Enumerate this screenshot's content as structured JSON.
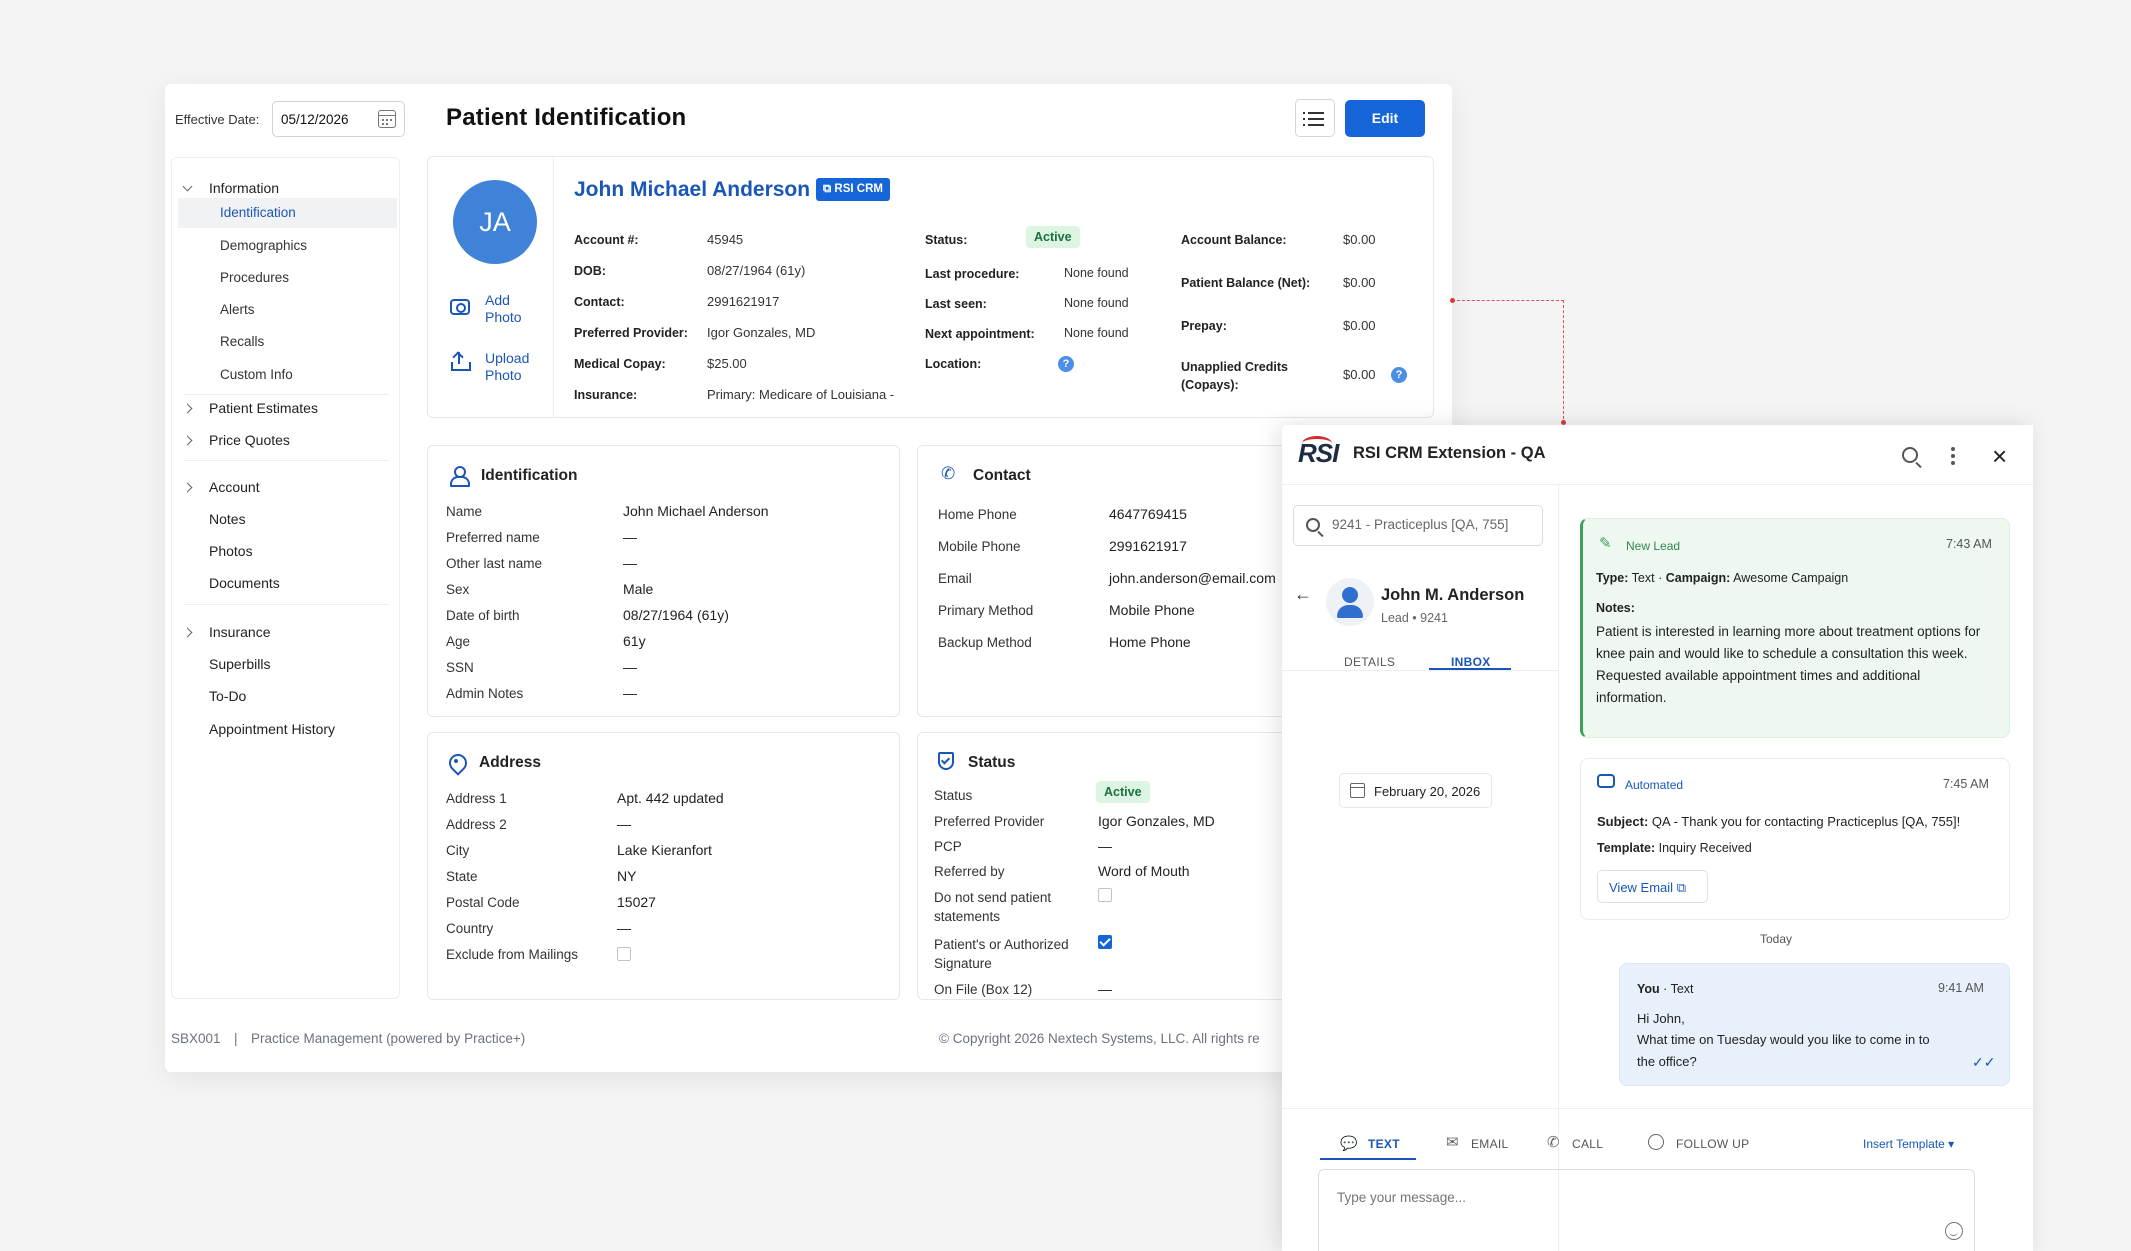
{
  "header": {
    "effective_date_label": "Effective Date:",
    "effective_date_value": "05/12/2026",
    "page_title": "Patient Identification",
    "edit_label": "Edit"
  },
  "nav": {
    "information": "Information",
    "info_items": [
      "Identification",
      "Demographics",
      "Procedures",
      "Alerts",
      "Recalls",
      "Custom Info"
    ],
    "patient_estimates": "Patient Estimates",
    "price_quotes": "Price Quotes",
    "account": "Account",
    "account_items": [
      "Notes",
      "Photos",
      "Documents"
    ],
    "insurance": "Insurance",
    "insurance_items": [
      "Superbills",
      "To-Do",
      "Appointment History"
    ]
  },
  "footer": {
    "code": "SBX001",
    "sep": "|",
    "product": "Practice Management (powered by Practice+)",
    "copyright": "© Copyright 2026 Nextech Systems, LLC. All rights re"
  },
  "summary": {
    "initials": "JA",
    "add_photo": "Add Photo",
    "upload_photo": "Upload Photo",
    "name": "John Michael Anderson",
    "crm_badge": "RSI CRM",
    "col1": [
      [
        "Account #:",
        "45945"
      ],
      [
        "DOB:",
        "08/27/1964 (61y)"
      ],
      [
        "Contact:",
        "2991621917"
      ],
      [
        "Preferred Provider:",
        "Igor Gonzales, MD"
      ],
      [
        "Medical Copay:",
        "$25.00"
      ],
      [
        "Insurance:",
        "Primary: Medicare of Louisiana -"
      ]
    ],
    "status_label": "Status:",
    "status_value": "Active",
    "col2": [
      [
        "Last procedure:",
        "None found"
      ],
      [
        "Last seen:",
        "None found"
      ],
      [
        "Next appointment:",
        "None found"
      ],
      [
        "Location:",
        ""
      ]
    ],
    "col3": [
      [
        "Account Balance:",
        "$0.00"
      ],
      [
        "Patient Balance (Net):",
        "$0.00"
      ],
      [
        "Prepay:",
        "$0.00"
      ],
      [
        "Unapplied Credits (Copays):",
        "$0.00"
      ]
    ]
  },
  "identification": {
    "title": "Identification",
    "rows": [
      [
        "Name",
        "John Michael Anderson"
      ],
      [
        "Preferred name",
        "—"
      ],
      [
        "Other last name",
        "—"
      ],
      [
        "Sex",
        "Male"
      ],
      [
        "Date of birth",
        "08/27/1964 (61y)"
      ],
      [
        "Age",
        "61y"
      ],
      [
        "SSN",
        "—"
      ],
      [
        "Admin Notes",
        "—"
      ]
    ]
  },
  "contact": {
    "title": "Contact",
    "rows": [
      [
        "Home Phone",
        "4647769415"
      ],
      [
        "Mobile Phone",
        "2991621917"
      ],
      [
        "Email",
        "john.anderson@email.com"
      ],
      [
        "Primary Method",
        "Mobile Phone"
      ],
      [
        "Backup Method",
        "Home Phone"
      ]
    ]
  },
  "address": {
    "title": "Address",
    "rows": [
      [
        "Address 1",
        "Apt. 442 updated"
      ],
      [
        "Address 2",
        "—"
      ],
      [
        "City",
        "Lake Kieranfort"
      ],
      [
        "State",
        "NY"
      ],
      [
        "Postal Code",
        "15027"
      ],
      [
        "Country",
        "—"
      ]
    ],
    "exclude_label": "Exclude from Mailings"
  },
  "status": {
    "title": "Status",
    "status_label": "Status",
    "status_value": "Active",
    "rows": [
      [
        "Preferred Provider",
        "Igor Gonzales, MD"
      ],
      [
        "PCP",
        "—"
      ],
      [
        "Referred by",
        "Word of Mouth"
      ]
    ],
    "no_statements": "Do not send patient statements",
    "signature": "Patient's or Authorized Signature",
    "on_file_label": "On File (Box 12)",
    "on_file_value": "—"
  },
  "crm": {
    "logo": "RSI",
    "title": "RSI CRM Extension - QA",
    "search_value": "9241 - Practiceplus [QA, 755]",
    "lead_name": "John M. Anderson",
    "lead_sub": "Lead • 9241",
    "tabs": [
      "DETAILS",
      "INBOX"
    ],
    "date_chip": "February 20, 2026",
    "new_lead": {
      "label": "New Lead",
      "time": "7:43 AM",
      "type_label": "Type:",
      "type_value": "Text",
      "campaign_label": "Campaign:",
      "campaign_value": "Awesome Campaign",
      "notes_label": "Notes:",
      "notes": "Patient is interested in learning more about treatment options for knee pain and would like to schedule a consultation this week. Requested available appointment times and additional information."
    },
    "automated": {
      "label": "Automated",
      "time": "7:45 AM",
      "subject_label": "Subject:",
      "subject": "QA - Thank you for contacting Practiceplus [QA, 755]!",
      "template_label": "Template:",
      "template": "Inquiry Received",
      "view_email": "View Email"
    },
    "today": "Today",
    "message": {
      "from": "You",
      "channel": "Text",
      "time": "9:41 AM",
      "text1": "Hi John,",
      "text2": "What time on Tuesday would you like to come in to the office?"
    },
    "compose_tabs": [
      "TEXT",
      "EMAIL",
      "CALL",
      "FOLLOW UP"
    ],
    "insert_template": "Insert Template",
    "placeholder": "Type your message..."
  },
  "colors": {
    "primary": "#1565d8",
    "active_badge": "#dcf5e3",
    "new_lead_bg": "#eef8f0",
    "message_bg": "#e8f0fb",
    "connector": "#e05252"
  }
}
